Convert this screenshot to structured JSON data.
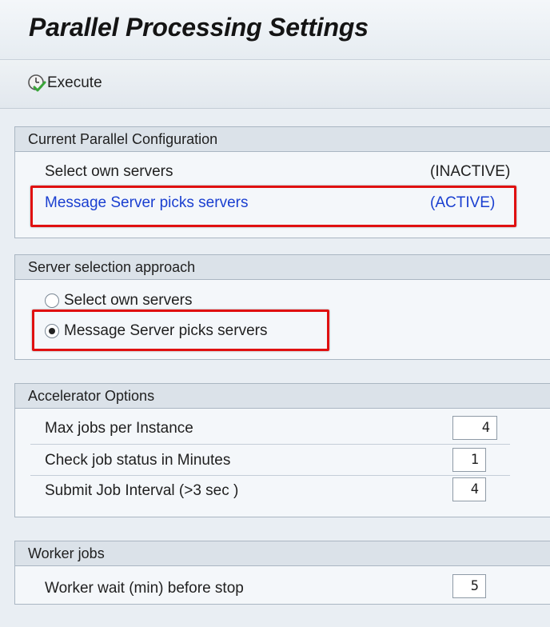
{
  "header": {
    "title": "Parallel Processing Settings"
  },
  "toolbar": {
    "execute_label": "Execute"
  },
  "current_config": {
    "heading": "Current Parallel Configuration",
    "rows": [
      {
        "label": "Select own servers",
        "status": "(INACTIVE)"
      },
      {
        "label": "Message Server picks servers",
        "status": "(ACTIVE)"
      }
    ]
  },
  "server_selection": {
    "heading": "Server selection approach",
    "options": [
      {
        "label": "Select own servers",
        "selected": false
      },
      {
        "label": "Message Server picks servers",
        "selected": true
      }
    ]
  },
  "accelerator": {
    "heading": "Accelerator Options",
    "fields": [
      {
        "label": "Max jobs per Instance",
        "value": "4"
      },
      {
        "label": "Check job status in Minutes",
        "value": "1"
      },
      {
        "label": "Submit Job Interval (>3 sec )",
        "value": "4"
      }
    ]
  },
  "worker": {
    "heading": "Worker jobs",
    "fields": [
      {
        "label": "Worker wait (min) before stop",
        "value": "5"
      }
    ]
  },
  "colors": {
    "active_blue": "#1a3fd0",
    "highlight_red": "#e01010",
    "check_green": "#3aa63a"
  },
  "icons": {
    "execute": "execute-clock-check-icon"
  }
}
